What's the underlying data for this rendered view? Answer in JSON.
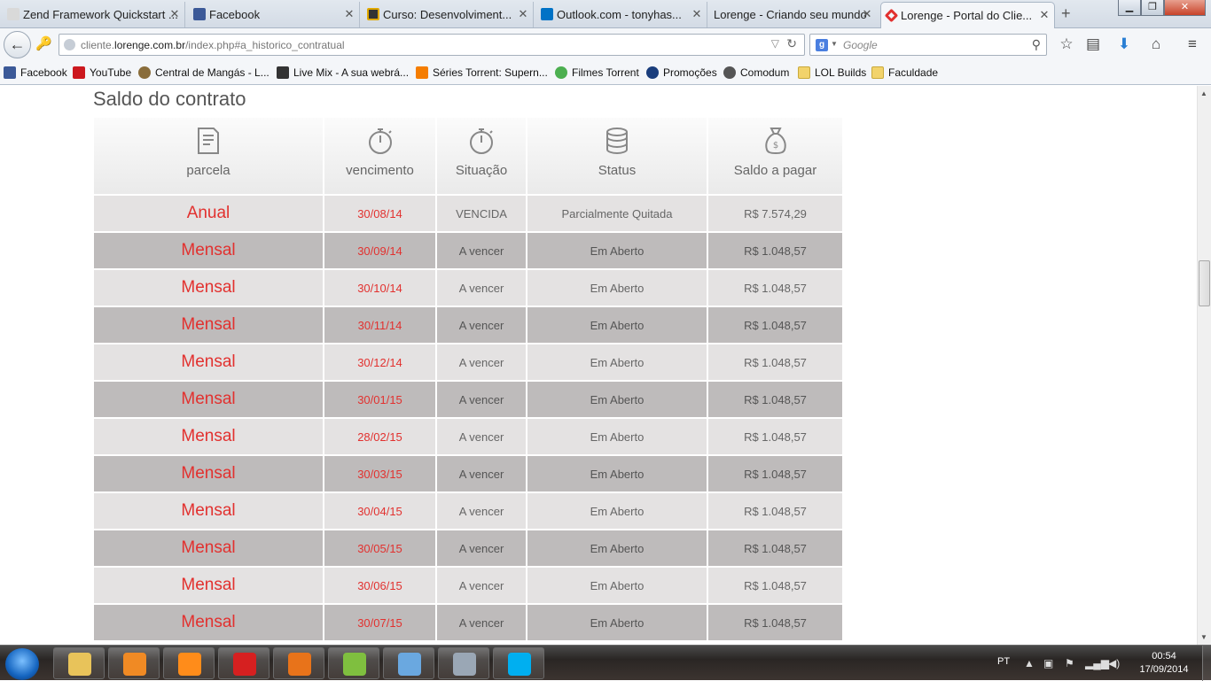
{
  "browser": {
    "tabs": [
      {
        "label": "Zend Framework Quickstart ...",
        "favicon_color": "#d9d9d9"
      },
      {
        "label": "Facebook",
        "favicon_color": "#3b5998"
      },
      {
        "label": "Curso: Desenvolviment...",
        "favicon_color": "#333333"
      },
      {
        "label": "Outlook.com - tonyhas...",
        "favicon_color": "#0072c6"
      },
      {
        "label": "Lorenge - Criando seu mundo",
        "favicon_color": "#d9d9d9"
      },
      {
        "label": "Lorenge - Portal do Clie...",
        "favicon_color": "#e2312f"
      }
    ],
    "url": {
      "prefix": "cliente.",
      "domain": "lorenge.com.br",
      "path": "/index.php#a_historico_contratual"
    },
    "search_placeholder": "Google",
    "search_engine_letter": "g",
    "bookmarks": [
      {
        "label": "Facebook",
        "icon_color": "#3b5998"
      },
      {
        "label": "YouTube",
        "icon_color": "#cc181e"
      },
      {
        "label": "Central de Mangás - L...",
        "icon_color": "#8a6d3b"
      },
      {
        "label": "Live Mix - A sua webrá...",
        "icon_color": "#333333"
      },
      {
        "label": "Séries Torrent: Supern...",
        "icon_color": "#f57d00"
      },
      {
        "label": "Filmes Torrent",
        "icon_color": "#4caf50"
      },
      {
        "label": "Promoções",
        "icon_color": "#1a3d7c"
      },
      {
        "label": "Comodum",
        "icon_color": "#555555"
      },
      {
        "label": "LOL Builds",
        "icon_color": "#f2d36b"
      },
      {
        "label": "Faculdade",
        "icon_color": "#f2d36b"
      }
    ]
  },
  "page": {
    "section_title": "Saldo do contrato",
    "columns": [
      {
        "label": "parcela",
        "icon": "document-icon"
      },
      {
        "label": "vencimento",
        "icon": "stopwatch-icon"
      },
      {
        "label": "Situação",
        "icon": "stopwatch-icon"
      },
      {
        "label": "Status",
        "icon": "coins-icon"
      },
      {
        "label": "Saldo a pagar",
        "icon": "money-bag-icon"
      }
    ],
    "rows": [
      {
        "parcela": "Anual",
        "vencimento": "30/08/14",
        "situacao": "VENCIDA",
        "status": "Parcialmente Quitada",
        "saldo": "R$ 7.574,29"
      },
      {
        "parcela": "Mensal",
        "vencimento": "30/09/14",
        "situacao": "A vencer",
        "status": "Em Aberto",
        "saldo": "R$ 1.048,57"
      },
      {
        "parcela": "Mensal",
        "vencimento": "30/10/14",
        "situacao": "A vencer",
        "status": "Em Aberto",
        "saldo": "R$ 1.048,57"
      },
      {
        "parcela": "Mensal",
        "vencimento": "30/11/14",
        "situacao": "A vencer",
        "status": "Em Aberto",
        "saldo": "R$ 1.048,57"
      },
      {
        "parcela": "Mensal",
        "vencimento": "30/12/14",
        "situacao": "A vencer",
        "status": "Em Aberto",
        "saldo": "R$ 1.048,57"
      },
      {
        "parcela": "Mensal",
        "vencimento": "30/01/15",
        "situacao": "A vencer",
        "status": "Em Aberto",
        "saldo": "R$ 1.048,57"
      },
      {
        "parcela": "Mensal",
        "vencimento": "28/02/15",
        "situacao": "A vencer",
        "status": "Em Aberto",
        "saldo": "R$ 1.048,57"
      },
      {
        "parcela": "Mensal",
        "vencimento": "30/03/15",
        "situacao": "A vencer",
        "status": "Em Aberto",
        "saldo": "R$ 1.048,57"
      },
      {
        "parcela": "Mensal",
        "vencimento": "30/04/15",
        "situacao": "A vencer",
        "status": "Em Aberto",
        "saldo": "R$ 1.048,57"
      },
      {
        "parcela": "Mensal",
        "vencimento": "30/05/15",
        "situacao": "A vencer",
        "status": "Em Aberto",
        "saldo": "R$ 1.048,57"
      },
      {
        "parcela": "Mensal",
        "vencimento": "30/06/15",
        "situacao": "A vencer",
        "status": "Em Aberto",
        "saldo": "R$ 1.048,57"
      },
      {
        "parcela": "Mensal",
        "vencimento": "30/07/15",
        "situacao": "A vencer",
        "status": "Em Aberto",
        "saldo": "R$ 1.048,57"
      }
    ],
    "accent_color": "#e2312f"
  },
  "taskbar": {
    "apps": [
      {
        "name": "explorer-icon",
        "color": "#e8c35a"
      },
      {
        "name": "media-player-icon",
        "color": "#f08a24"
      },
      {
        "name": "orange-ball-icon",
        "color": "#ff8c1a"
      },
      {
        "name": "antivirus-icon",
        "color": "#d62020"
      },
      {
        "name": "firefox-icon",
        "color": "#e8731a"
      },
      {
        "name": "notepad-icon",
        "color": "#7fbf3f"
      },
      {
        "name": "cube-icon",
        "color": "#6aa8e0"
      },
      {
        "name": "database-icon",
        "color": "#9aa7b5"
      },
      {
        "name": "skype-icon",
        "color": "#00aff0"
      }
    ],
    "language": "PT",
    "time": "00:54",
    "date": "17/09/2014"
  }
}
